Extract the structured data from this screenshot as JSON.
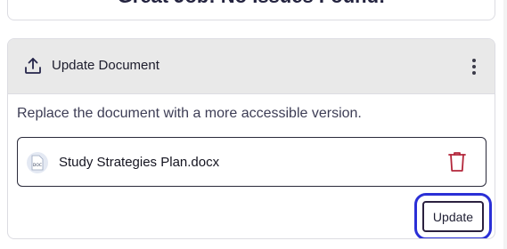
{
  "top_card": {
    "message": "Great Job! No Issues Found!"
  },
  "panel": {
    "title": "Update Document",
    "title_icon": "upload-icon",
    "menu_icon": "more-vertical-icon",
    "description": "Replace the document with a more accessible version.",
    "file": {
      "icon": "doc-file-icon",
      "icon_label": "DOC",
      "name": "Study Strategies Plan.docx",
      "delete_icon": "trash-icon"
    },
    "update_label": "Update"
  },
  "colors": {
    "header_bg": "#e9e9e9",
    "focus_ring": "#2a2fd6",
    "delete": "#b3263a"
  }
}
